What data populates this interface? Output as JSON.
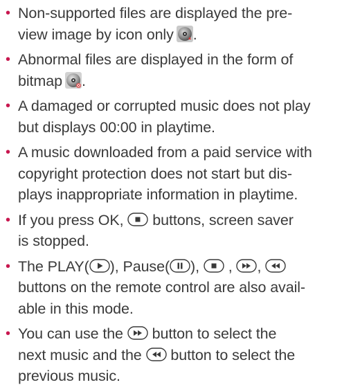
{
  "bullet_glyph": "•",
  "bullet_color": "#c8174f",
  "items": [
    {
      "line1": "Non-supported files are displayed the pre-",
      "line2": "view image by icon only",
      "line2_end": "."
    },
    {
      "line1": "Abnormal files are displayed in the form of",
      "line2": "bitmap",
      "line2_end": "."
    },
    {
      "line1": "A damaged or corrupted music does not play",
      "line2": "but displays 00:00 in playtime."
    },
    {
      "line1": "A music downloaded from a paid service with",
      "line2": "copyright protection does not start but dis-",
      "line3": "plays inappropriate information in playtime."
    },
    {
      "line1_a": "If you press OK,",
      "line1_b": "buttons, screen saver",
      "line2": "is stopped."
    },
    {
      "line1_a": "The PLAY(",
      "line1_b": "), Pause(",
      "line1_c": "),",
      "line1_d": ",",
      "line1_e": ",",
      "line2": "buttons on the remote control are also avail-",
      "line3": "able in this mode."
    },
    {
      "line1_a": "You can use the",
      "line1_b": "button to select the",
      "line2_a": "next music and the",
      "line2_b": "button to select the",
      "line3": "previous music."
    }
  ]
}
